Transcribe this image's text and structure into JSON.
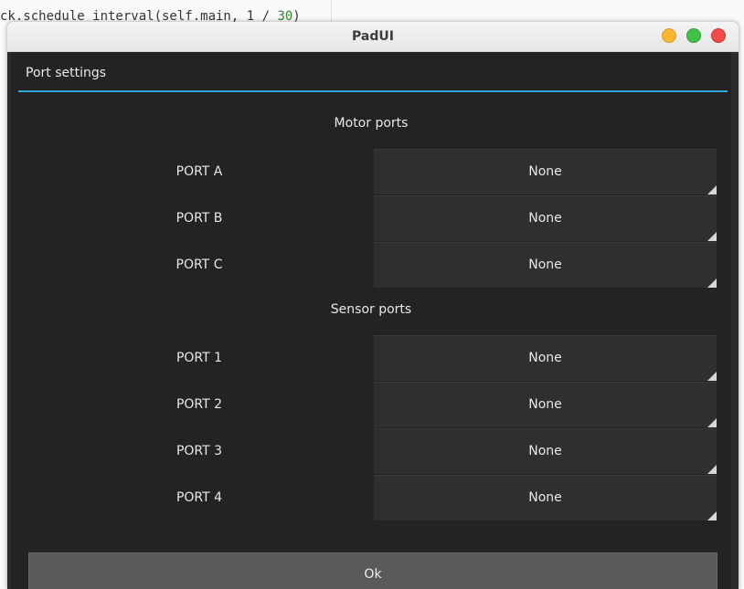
{
  "background": {
    "code_prefix": "ck.schedule_interval(self.main, 1 / ",
    "code_number": "30",
    "code_suffix": ")"
  },
  "window": {
    "title": "PadUI"
  },
  "popup": {
    "title": "Port settings",
    "motor_section": {
      "title": "Motor ports",
      "ports": [
        {
          "label": "PORT A",
          "value": "None"
        },
        {
          "label": "PORT B",
          "value": "None"
        },
        {
          "label": "PORT C",
          "value": "None"
        }
      ]
    },
    "sensor_section": {
      "title": "Sensor ports",
      "ports": [
        {
          "label": "PORT 1",
          "value": "None"
        },
        {
          "label": "PORT 2",
          "value": "None"
        },
        {
          "label": "PORT 3",
          "value": "None"
        },
        {
          "label": "PORT 4",
          "value": "None"
        }
      ]
    },
    "ok_label": "Ok"
  },
  "colors": {
    "accent": "#33a6d9",
    "background": "#232323",
    "button": "#5a5a5a"
  }
}
